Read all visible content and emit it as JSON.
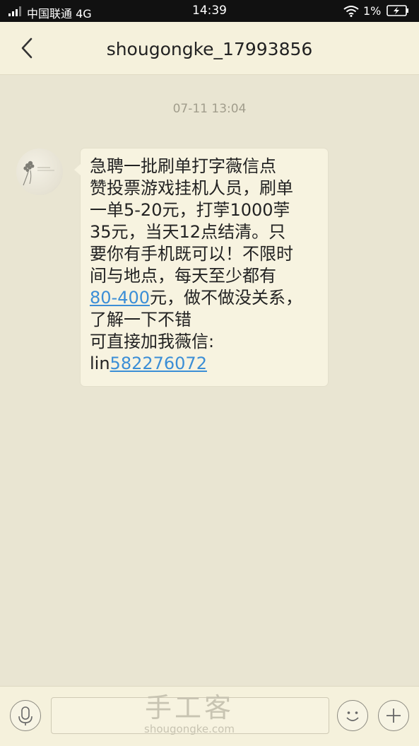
{
  "status_bar": {
    "carrier": "中国联通 4G",
    "time": "14:39",
    "battery_percent": "1%"
  },
  "header": {
    "title": "shougongke_17993856"
  },
  "conversation": {
    "timestamp": "07-11 13:04",
    "message": {
      "line1": "  急聘一批刷单打字薇信点",
      "line2": "赞投票游戏挂机人员，刷单",
      "line3": "一单5-20元，打荢1000荢",
      "line4": "35元，当天12点结清。只",
      "line5": "要你有手机既可以！不限时",
      "line6": "间与地点，每天至少都有",
      "line7_link": "80-400",
      "line7_rest": "元，做不做没关系，",
      "line8": "了解一下不错",
      "line9": "可直接加我薇信:",
      "line10_prefix": "lin",
      "line10_link": "582276072"
    }
  },
  "watermark": {
    "brand": "手工客",
    "domain": "shougongke.com"
  },
  "colors": {
    "background": "#e9e5d2",
    "link": "#3b8ed6"
  }
}
